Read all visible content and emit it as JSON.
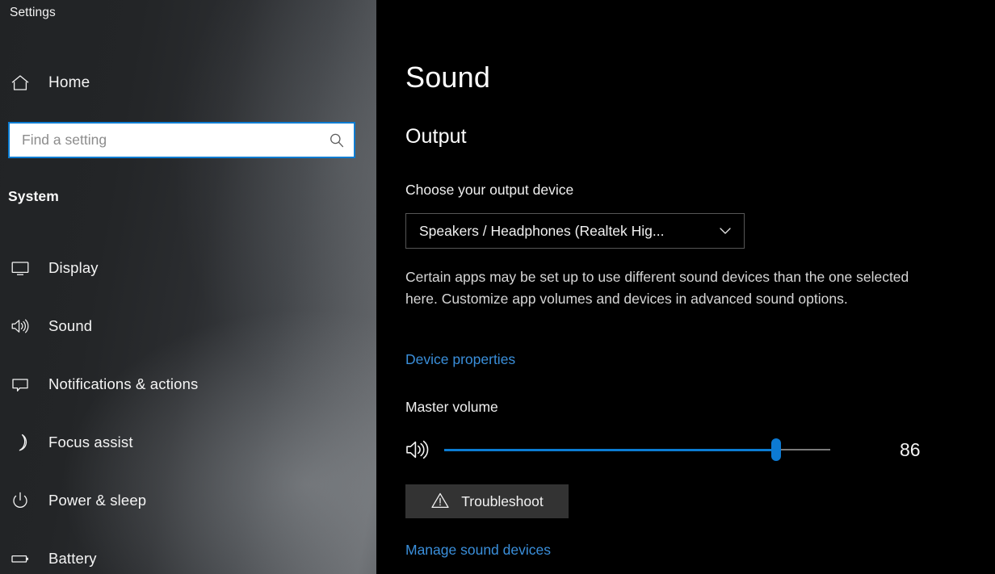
{
  "window": {
    "title": "Settings"
  },
  "sidebar": {
    "home_label": "Home",
    "home_icon": "home-icon",
    "search": {
      "placeholder": "Find a setting",
      "value": "",
      "icon": "search-icon"
    },
    "section_label": "System",
    "items": [
      {
        "label": "Display",
        "icon": "monitor-icon",
        "selected": false
      },
      {
        "label": "Sound",
        "icon": "speaker-icon",
        "selected": false
      },
      {
        "label": "Notifications & actions",
        "icon": "speech-bubble-icon",
        "selected": false
      },
      {
        "label": "Focus assist",
        "icon": "crescent-moon-icon",
        "selected": false
      },
      {
        "label": "Power & sleep",
        "icon": "power-icon",
        "selected": false
      },
      {
        "label": "Battery",
        "icon": "battery-icon",
        "selected": false
      }
    ]
  },
  "main": {
    "page_title": "Sound",
    "output_section": {
      "heading": "Output",
      "device_label": "Choose your output device",
      "device_value": "Speakers / Headphones (Realtek Hig...",
      "device_chevron_icon": "chevron-down-icon",
      "description": "Certain apps may be set up to use different sound devices than the one selected here. Customize app volumes and devices in advanced sound options.",
      "device_properties_link": "Device properties",
      "volume_label": "Master volume",
      "volume_icon": "speaker-icon",
      "volume_value": "86",
      "volume_min": 0,
      "volume_max": 100,
      "troubleshoot_label": "Troubleshoot",
      "troubleshoot_icon": "warning-triangle-icon",
      "manage_devices_link": "Manage sound devices"
    }
  },
  "colors": {
    "accent": "#0b7cd2",
    "link": "#3a8fdb",
    "content_bg": "#000000",
    "button_bg": "#333333",
    "search_bg": "#ffffff"
  }
}
